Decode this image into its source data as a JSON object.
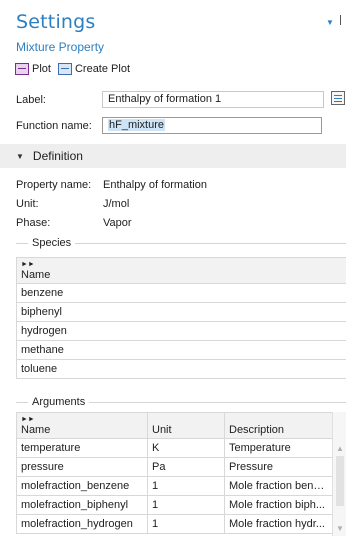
{
  "panel": {
    "title": "Settings",
    "subtitle": "Mixture Property",
    "toolbar": {
      "plot_label": "Plot",
      "create_plot_label": "Create Plot"
    }
  },
  "fields": {
    "label": {
      "label": "Label:",
      "value": "Enthalpy of formation 1"
    },
    "function_name": {
      "label": "Function name:",
      "value": "hF_mixture"
    }
  },
  "definition": {
    "header": "Definition",
    "properties": [
      {
        "key": "Property name:",
        "value": "Enthalpy of formation"
      },
      {
        "key": "Unit:",
        "value": "J/mol"
      },
      {
        "key": "Phase:",
        "value": "Vapor"
      }
    ]
  },
  "species": {
    "group_label": "Species",
    "column_header": "Name",
    "rows": [
      "benzene",
      "biphenyl",
      "hydrogen",
      "methane",
      "toluene"
    ]
  },
  "arguments": {
    "group_label": "Arguments",
    "columns": [
      "Name",
      "Unit",
      "Description"
    ],
    "rows": [
      {
        "name": "temperature",
        "unit": "K",
        "description": "Temperature"
      },
      {
        "name": "pressure",
        "unit": "Pa",
        "description": "Pressure"
      },
      {
        "name": "molefraction_benzene",
        "unit": "1",
        "description": "Mole fraction benz..."
      },
      {
        "name": "molefraction_biphenyl",
        "unit": "1",
        "description": "Mole fraction biph..."
      },
      {
        "name": "molefraction_hydrogen",
        "unit": "1",
        "description": "Mole fraction hydr..."
      }
    ]
  },
  "glyphs": {
    "collapse": "▼",
    "expanded_caret": "▼",
    "column_arrows": "►►",
    "scroll_up": "▲",
    "scroll_down": "▼"
  },
  "colors": {
    "title": "#2d7fc1",
    "section_bg": "#eeeeee",
    "selection": "#cde4f7"
  }
}
